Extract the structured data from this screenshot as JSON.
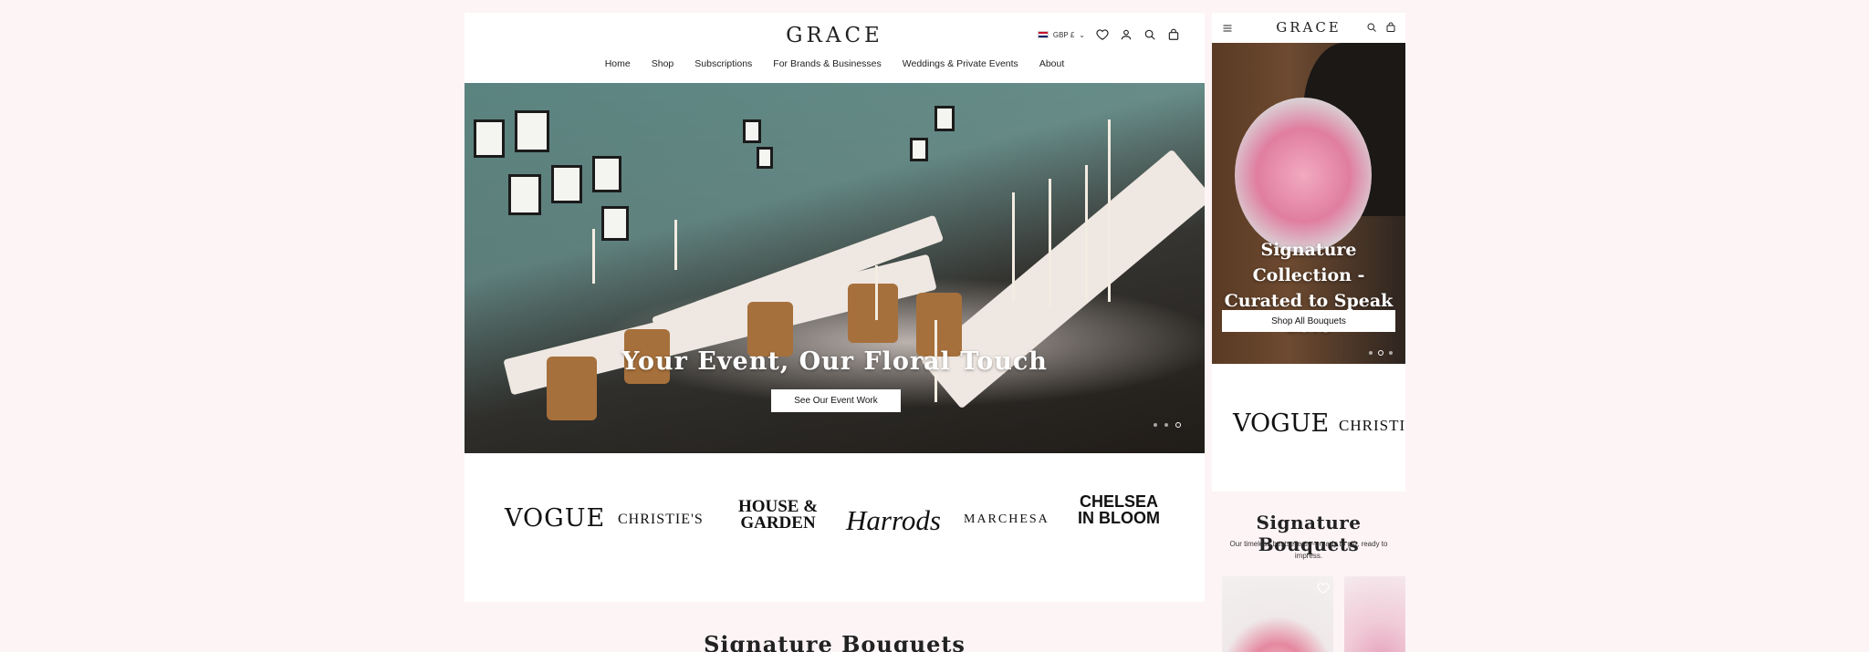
{
  "colors": {
    "page_background": "#fdf4f6",
    "header": "#ffffff",
    "text": "#1a1a1a"
  },
  "desktop": {
    "logo": "GRACE",
    "currency": {
      "label": "GBP £",
      "flag": "uk-flag-icon"
    },
    "header_icons": [
      "heart-icon",
      "user-icon",
      "search-icon",
      "bag-icon"
    ],
    "nav": [
      "Home",
      "Shop",
      "Subscriptions",
      "For Brands & Businesses",
      "Weddings & Private Events",
      "About"
    ],
    "hero": {
      "title": "Your Event, Our Floral Touch",
      "button": "See Our Event Work",
      "slides": 3,
      "active_slide": 3
    },
    "press_logos": [
      "VOGUE",
      "CHRISTIE'S",
      "HOUSE & GARDEN",
      "Harrods",
      "MARCHESA",
      "CHELSEA IN BLOOM"
    ],
    "section_title": "Signature Bouquets"
  },
  "mobile": {
    "logo": "GRACE",
    "header_icons": [
      "menu-icon",
      "search-icon",
      "bag-icon"
    ],
    "hero": {
      "title": "Signature Collection - Curated to Speak Love",
      "button": "Shop All Bouquets",
      "slides": 3,
      "active_slide": 2
    },
    "press_logos": [
      "VOGUE",
      "CHRISTIE"
    ],
    "section_title": "Signature Bouquets",
    "section_subtitle": "Our timeless bestsellers — ready to gift, ready to impress."
  }
}
